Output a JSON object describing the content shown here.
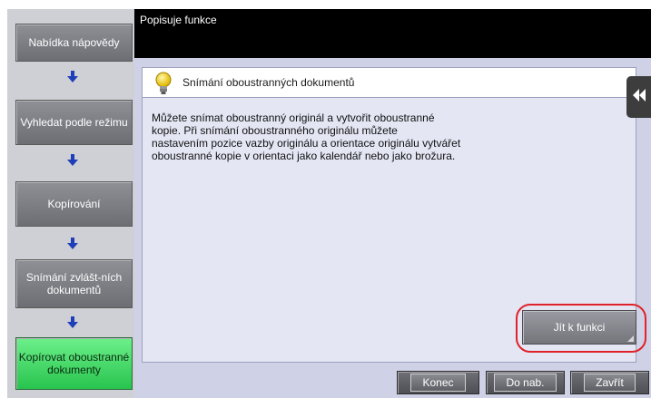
{
  "header": {
    "title": "Popisuje funkce"
  },
  "nav": {
    "items": [
      {
        "label": "Nabídka nápovědy",
        "active": false
      },
      {
        "label": "Vyhledat podle režimu",
        "active": false
      },
      {
        "label": "Kopírování",
        "active": false
      },
      {
        "label": "Snímání zvlášt-ních dokumentů",
        "active": false
      },
      {
        "label": "Kopírovat oboustranné dokumenty",
        "active": true
      }
    ],
    "arrow_color": "#1f3fb8"
  },
  "panel": {
    "title": "Snímání oboustranných dokumentů",
    "icon": "lightbulb-icon",
    "description": "Můžete snímat oboustranný originál a vytvořit oboustranné\nkopie. Při snímání oboustranného originálu můžete\nnastavením pozice vazby originálu a orientace originálu vytvářet\noboustranné kopie v orientaci jako kalendář nebo jako brožura."
  },
  "actions": {
    "go_to_function": "Jít k funkci"
  },
  "footer": {
    "end": "Konec",
    "back": "Do nab.",
    "close": "Zavřít"
  },
  "colors": {
    "header_bg": "#000000",
    "main_bg": "#cfd2e6",
    "active_item": "#3ddc64",
    "highlight_ring": "#e0222a"
  }
}
